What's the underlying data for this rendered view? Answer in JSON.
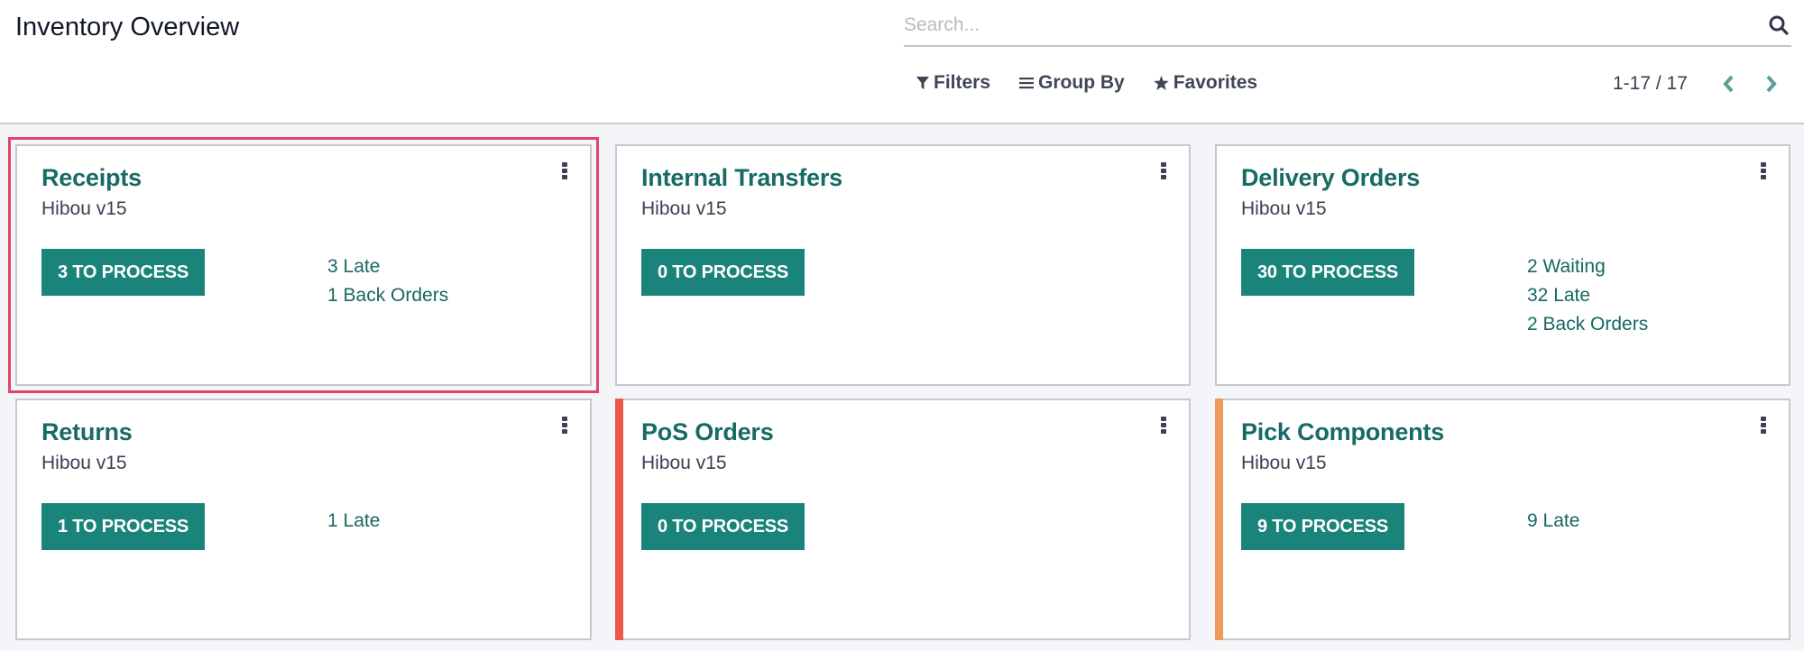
{
  "header": {
    "title": "Inventory Overview",
    "search": {
      "placeholder": "Search...",
      "value": ""
    },
    "filters": [
      {
        "label": "Filters",
        "icon": "filter-icon"
      },
      {
        "label": "Group By",
        "icon": "bars-icon"
      },
      {
        "label": "Favorites",
        "icon": "star-icon"
      }
    ],
    "pager": {
      "value": "1-17 / 17",
      "prev_icon": "chevron-left-icon",
      "next_icon": "chevron-right-icon"
    }
  },
  "colors": {
    "accent": "#1a847b",
    "title": "#176b63",
    "selected_outline": "#e2456a",
    "pos_bar": "#e9594c",
    "pick_bar": "#ee9a5c"
  },
  "cards": [
    {
      "title": "Receipts",
      "subtitle": "Hibou v15",
      "button": "3 TO PROCESS",
      "links": [
        "3 Late",
        "1 Back Orders"
      ],
      "selected": true,
      "bar_color": ""
    },
    {
      "title": "Internal Transfers",
      "subtitle": "Hibou v15",
      "button": "0 TO PROCESS",
      "links": [],
      "selected": false,
      "bar_color": ""
    },
    {
      "title": "Delivery Orders",
      "subtitle": "Hibou v15",
      "button": "30 TO PROCESS",
      "links": [
        "2 Waiting",
        "32 Late",
        "2 Back Orders"
      ],
      "selected": false,
      "bar_color": ""
    },
    {
      "title": "Returns",
      "subtitle": "Hibou v15",
      "button": "1 TO PROCESS",
      "links": [
        "1 Late"
      ],
      "selected": false,
      "bar_color": ""
    },
    {
      "title": "PoS Orders",
      "subtitle": "Hibou v15",
      "button": "0 TO PROCESS",
      "links": [],
      "selected": false,
      "bar_color": "#e9594c"
    },
    {
      "title": "Pick Components",
      "subtitle": "Hibou v15",
      "button": "9 TO PROCESS",
      "links": [
        "9 Late"
      ],
      "selected": false,
      "bar_color": "#ee9a5c"
    }
  ]
}
